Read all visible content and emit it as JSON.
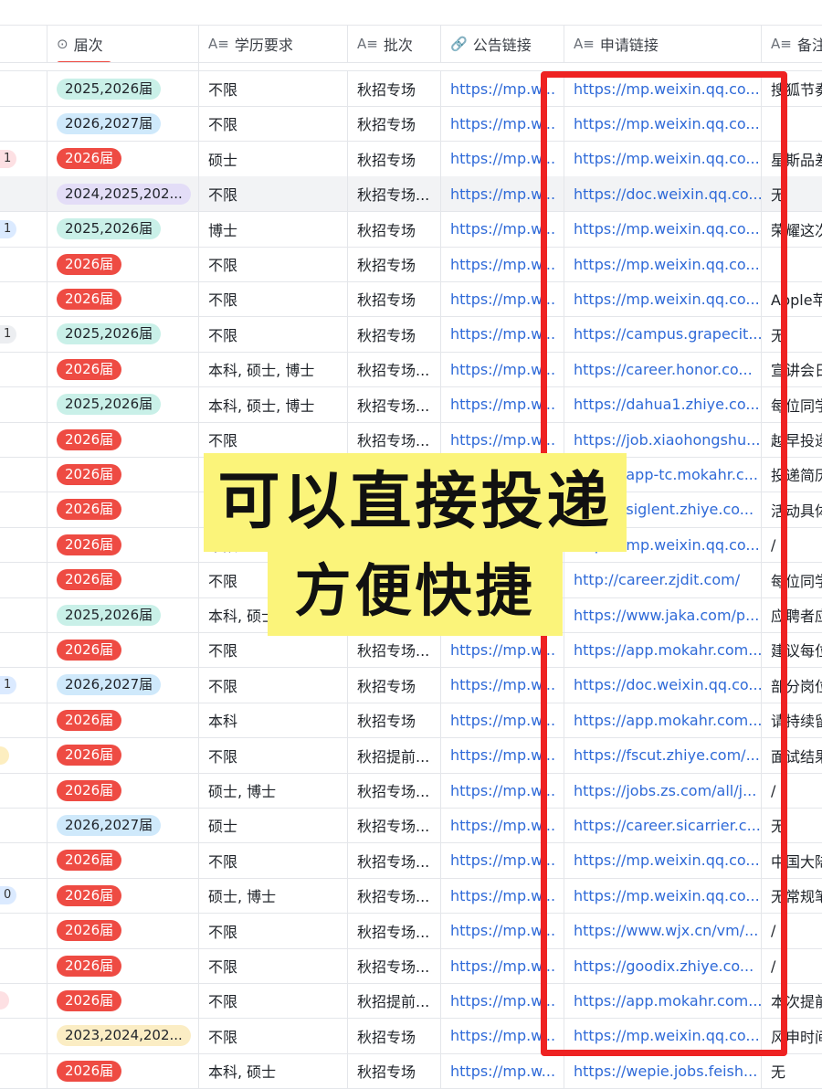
{
  "headers": [
    {
      "icon": "⊙",
      "name": "届次"
    },
    {
      "icon": "A≡",
      "name": "学历要求"
    },
    {
      "icon": "A≡",
      "name": "批次"
    },
    {
      "icon": "🔗",
      "name": "公告链接"
    },
    {
      "icon": "A≡",
      "name": "申请链接"
    },
    {
      "icon": "A≡",
      "name": "备注"
    }
  ],
  "rows": [
    {
      "stub": "",
      "stub_color": "",
      "tag": "2025,2026届",
      "tag_color": "teal",
      "edu": "不限",
      "batch": "秋招专场",
      "notice": "https://mp.w...",
      "apply": "https://mp.weixin.qq.co...",
      "note": "搜狐节奏"
    },
    {
      "stub": "",
      "stub_color": "",
      "tag": "2026,2027届",
      "tag_color": "blue",
      "edu": "不限",
      "batch": "秋招专场",
      "notice": "https://mp.w...",
      "apply": "https://mp.weixin.qq.co...",
      "note": ""
    },
    {
      "stub": "1",
      "stub_color": "pink",
      "tag": "2026届",
      "tag_color": "red",
      "edu": "硕士",
      "batch": "秋招专场",
      "notice": "https://mp.w...",
      "apply": "https://mp.weixin.qq.co...",
      "note": "星斯品差"
    },
    {
      "stub": "",
      "stub_color": "",
      "tag": "2024,2025,202...",
      "tag_color": "purple",
      "edu": "不限",
      "batch": "秋招专场...",
      "notice": "https://mp.w...",
      "apply": "https://doc.weixin.qq.co...",
      "note": "无"
    },
    {
      "stub": "1",
      "stub_color": "blue",
      "tag": "2025,2026届",
      "tag_color": "teal",
      "edu": "博士",
      "batch": "秋招专场",
      "notice": "https://mp.w...",
      "apply": "https://mp.weixin.qq.co...",
      "note": "荣耀这次"
    },
    {
      "stub": "",
      "stub_color": "",
      "tag": "2026届",
      "tag_color": "red",
      "edu": "不限",
      "batch": "秋招专场",
      "notice": "https://mp.w...",
      "apply": "https://mp.weixin.qq.co...",
      "note": ""
    },
    {
      "stub": "",
      "stub_color": "",
      "tag": "2026届",
      "tag_color": "red",
      "edu": "不限",
      "batch": "秋招专场",
      "notice": "https://mp.w...",
      "apply": "https://mp.weixin.qq.co...",
      "note": "Apple苹"
    },
    {
      "stub": "1",
      "stub_color": "grey",
      "tag": "2025,2026届",
      "tag_color": "teal",
      "edu": "不限",
      "batch": "秋招专场",
      "notice": "https://mp.w...",
      "apply": "https://campus.grapecit...",
      "note": "无"
    },
    {
      "stub": "",
      "stub_color": "",
      "tag": "2026届",
      "tag_color": "red",
      "edu": "本科, 硕士, 博士",
      "batch": "秋招专场...",
      "notice": "https://mp.w...",
      "apply": "https://career.honor.co...",
      "note": "宣讲会日"
    },
    {
      "stub": "",
      "stub_color": "",
      "tag": "2025,2026届",
      "tag_color": "teal",
      "edu": "本科, 硕士, 博士",
      "batch": "秋招专场...",
      "notice": "https://mp.w...",
      "apply": "https://dahua1.zhiye.co...",
      "note": "每位同学"
    },
    {
      "stub": "",
      "stub_color": "",
      "tag": "2026届",
      "tag_color": "red",
      "edu": "不限",
      "batch": "秋招专场...",
      "notice": "https://mp.w...",
      "apply": "https://job.xiaohongshu...",
      "note": "越早投递"
    },
    {
      "stub": "",
      "stub_color": "",
      "tag": "2026届",
      "tag_color": "red",
      "edu": "",
      "batch": "",
      "notice": "",
      "apply": "https://app-tc.mokahr.c...",
      "note": "投递简历"
    },
    {
      "stub": "",
      "stub_color": "",
      "tag": "2026届",
      "tag_color": "red",
      "edu": "",
      "batch": "",
      "notice": "",
      "apply": "https://siglent.zhiye.co...",
      "note": "活动具体"
    },
    {
      "stub": "",
      "stub_color": "",
      "tag": "2026届",
      "tag_color": "red",
      "edu": "不限",
      "batch": "",
      "notice": "",
      "apply": "https://mp.weixin.qq.co...",
      "note": "/"
    },
    {
      "stub": "",
      "stub_color": "",
      "tag": "2026届",
      "tag_color": "red",
      "edu": "不限",
      "batch": "",
      "notice": "",
      "apply": "http://career.zjdit.com/",
      "note": "每位同学"
    },
    {
      "stub": "",
      "stub_color": "",
      "tag": "2025,2026届",
      "tag_color": "teal",
      "edu": "本科, 硕士",
      "batch": "",
      "notice": "",
      "apply": "https://www.jaka.com/p...",
      "note": "应聘者应"
    },
    {
      "stub": "",
      "stub_color": "",
      "tag": "2026届",
      "tag_color": "red",
      "edu": "不限",
      "batch": "秋招专场...",
      "notice": "https://mp.w...",
      "apply": "https://app.mokahr.com...",
      "note": "建议每位"
    },
    {
      "stub": "1",
      "stub_color": "blue",
      "tag": "2026,2027届",
      "tag_color": "blue",
      "edu": "不限",
      "batch": "秋招专场",
      "notice": "https://mp.w...",
      "apply": "https://doc.weixin.qq.co...",
      "note": "部分岗位"
    },
    {
      "stub": "",
      "stub_color": "",
      "tag": "2026届",
      "tag_color": "red",
      "edu": "本科",
      "batch": "秋招专场",
      "notice": "https://mp.w...",
      "apply": "https://app.mokahr.com...",
      "note": "请持续留"
    },
    {
      "stub": "",
      "stub_color": "yellow",
      "tag": "2026届",
      "tag_color": "red",
      "edu": "不限",
      "batch": "秋招提前...",
      "notice": "https://mp.w...",
      "apply": "https://fscut.zhiye.com/...",
      "note": "面试结果"
    },
    {
      "stub": "",
      "stub_color": "",
      "tag": "2026届",
      "tag_color": "red",
      "edu": "硕士, 博士",
      "batch": "秋招专场...",
      "notice": "https://mp.w...",
      "apply": "https://jobs.zs.com/all/j...",
      "note": "/"
    },
    {
      "stub": "",
      "stub_color": "",
      "tag": "2026,2027届",
      "tag_color": "blue",
      "edu": "硕士",
      "batch": "秋招专场...",
      "notice": "https://mp.w...",
      "apply": "https://career.sicarrier.c...",
      "note": "无"
    },
    {
      "stub": "",
      "stub_color": "",
      "tag": "2026届",
      "tag_color": "red",
      "edu": "不限",
      "batch": "秋招专场...",
      "notice": "https://mp.w...",
      "apply": "https://mp.weixin.qq.co...",
      "note": "中国大陆"
    },
    {
      "stub": "0",
      "stub_color": "blue",
      "tag": "2026届",
      "tag_color": "red",
      "edu": "硕士, 博士",
      "batch": "秋招专场...",
      "notice": "https://mp.w...",
      "apply": "https://mp.weixin.qq.co...",
      "note": "无常规笔"
    },
    {
      "stub": "",
      "stub_color": "",
      "tag": "2026届",
      "tag_color": "red",
      "edu": "不限",
      "batch": "秋招专场...",
      "notice": "https://mp.w...",
      "apply": "https://www.wjx.cn/vm/...",
      "note": "/"
    },
    {
      "stub": "",
      "stub_color": "",
      "tag": "2026届",
      "tag_color": "red",
      "edu": "不限",
      "batch": "秋招专场...",
      "notice": "https://mp.w...",
      "apply": "https://goodix.zhiye.co...",
      "note": "/"
    },
    {
      "stub": "",
      "stub_color": "pink",
      "tag": "2026届",
      "tag_color": "red",
      "edu": "不限",
      "batch": "秋招提前...",
      "notice": "https://mp.w...",
      "apply": "https://app.mokahr.com...",
      "note": "本次提前"
    },
    {
      "stub": "",
      "stub_color": "",
      "tag": "2023,2024,202...",
      "tag_color": "yellow",
      "edu": "不限",
      "batch": "秋招专场",
      "notice": "https://mp.w...",
      "apply": "https://mp.weixin.qq.co...",
      "note": "风申时间"
    },
    {
      "stub": "",
      "stub_color": "",
      "tag": "2026届",
      "tag_color": "red",
      "edu": "本科, 硕士",
      "batch": "秋招专场",
      "notice": "https://mp.w...",
      "apply": "https://wepie.jobs.feish...",
      "note": "无"
    }
  ],
  "banner": {
    "line1": "可以直接投递",
    "line2": "方便快捷"
  },
  "colors": {
    "highlight_box": "#ee2222",
    "banner_bg": "#fbf47a",
    "link": "#2f6ad8",
    "tag_red": "#ee4b43"
  }
}
